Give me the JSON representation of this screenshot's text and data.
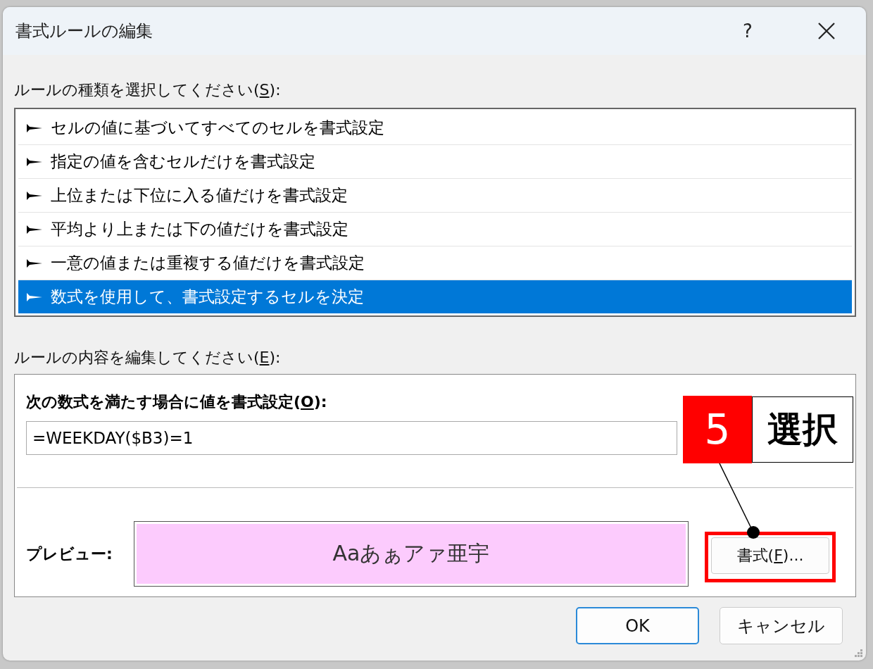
{
  "window": {
    "title": "書式ルールの編集",
    "help": "?"
  },
  "rule_type": {
    "label": {
      "before": "ルールの種類を選択してください(",
      "key": "S",
      "after": "):"
    },
    "items": [
      {
        "label": "セルの値に基づいてすべてのセルを書式設定",
        "selected": false
      },
      {
        "label": "指定の値を含むセルだけを書式設定",
        "selected": false
      },
      {
        "label": "上位または下位に入る値だけを書式設定",
        "selected": false
      },
      {
        "label": "平均より上または下の値だけを書式設定",
        "selected": false
      },
      {
        "label": "一意の値または重複する値だけを書式設定",
        "selected": false
      },
      {
        "label": "数式を使用して、書式設定するセルを決定",
        "selected": true
      }
    ]
  },
  "rule_edit": {
    "label": {
      "before": "ルールの内容を編集してください(",
      "key": "E",
      "after": "):"
    },
    "formula_label": {
      "before": "次の数式を満たす場合に値を書式設定(",
      "key": "O",
      "after": "):"
    },
    "formula": "=WEEKDAY($B3)=1",
    "preview_label": "プレビュー:",
    "preview": {
      "text": "Aaあぁアァ亜宇",
      "color": "#fccbfd"
    },
    "format_button": {
      "before": "書式(",
      "key": "F",
      "after": ")..."
    }
  },
  "buttons": [
    {
      "label": "OK",
      "default": true
    },
    {
      "label": "キャンセル",
      "default": false
    }
  ],
  "annotation": {
    "step": "5",
    "text": "選択"
  }
}
